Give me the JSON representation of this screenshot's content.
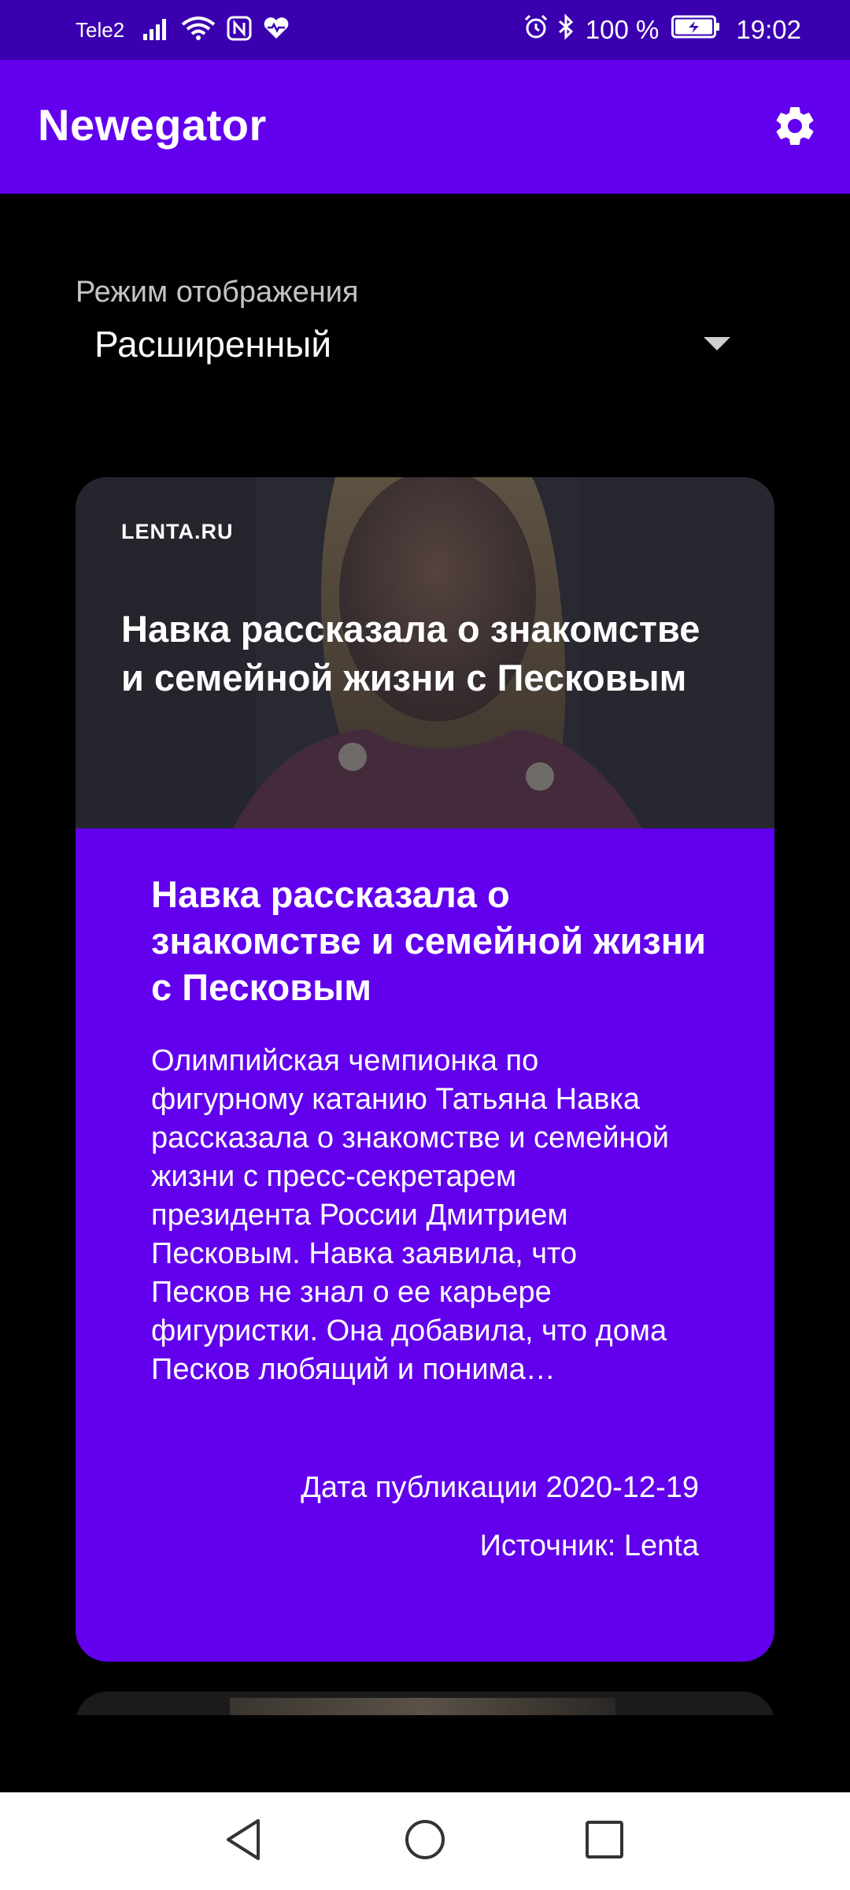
{
  "status_bar": {
    "carrier": "Tele2",
    "battery": "100 %",
    "time": "19:02",
    "icons": [
      "signal-icon",
      "wifi-icon",
      "nfc-icon",
      "health-icon",
      "alarm-icon",
      "bluetooth-icon",
      "battery-charging-icon"
    ]
  },
  "app_bar": {
    "title": "Newegator",
    "settings_icon": "gear-icon",
    "color": "#6200ee"
  },
  "display_mode": {
    "label": "Режим отображения",
    "value": "Расширенный"
  },
  "news_card": {
    "source_logo": "LENTA.RU",
    "image_title": "Навка рассказала о знакомстве и семейной жизни с Песковым",
    "title": "Навка рассказала о знакомстве и семейной жизни с Песковым",
    "description": "Олимпийская чемпионка по фигурному катанию Татьяна Навка рассказала о знакомстве и семейной жизни с пресс-секретарем президента России Дмитрием Песковым. Навка заявила, что Песков не знал о ее карьере фигуристки. Она добавила, что дома Песков любящий и понима…",
    "date": "Дата публикации 2020-12-19",
    "source": "Источник: Lenta",
    "color": "#6200ee"
  },
  "nav_bar": {
    "icons": [
      "back-icon",
      "home-icon",
      "recent-apps-icon"
    ]
  }
}
